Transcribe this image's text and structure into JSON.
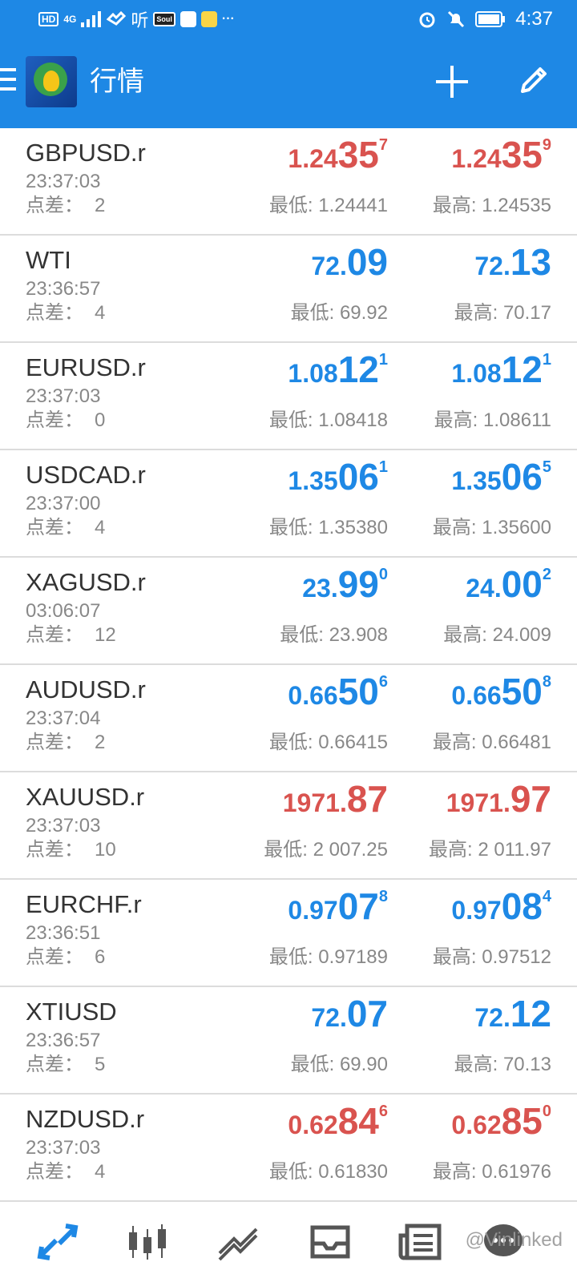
{
  "status_bar": {
    "hd": "HD",
    "network": "4G",
    "ting": "听",
    "soul": "Soul",
    "dots": "···",
    "time": "4:37"
  },
  "app_bar": {
    "title": "行情"
  },
  "labels": {
    "spread": "点差：",
    "low": "最低:",
    "high": "最高:"
  },
  "colors": {
    "accent": "#1e88e5",
    "down": "#d9534f",
    "up": "#1e88e5"
  },
  "quotes": [
    {
      "symbol": "GBPUSD.r",
      "time": "23:37:03",
      "spread": "2",
      "color": "red",
      "bid": {
        "s": "1.24",
        "b": "35",
        "t": "7"
      },
      "ask": {
        "s": "1.24",
        "b": "35",
        "t": "9"
      },
      "low": "1.24441",
      "high": "1.24535"
    },
    {
      "symbol": "WTI",
      "time": "23:36:57",
      "spread": "4",
      "color": "blue",
      "bid": {
        "s": "72.",
        "b": "09",
        "t": ""
      },
      "ask": {
        "s": "72.",
        "b": "13",
        "t": ""
      },
      "low": "69.92",
      "high": "70.17"
    },
    {
      "symbol": "EURUSD.r",
      "time": "23:37:03",
      "spread": "0",
      "color": "blue",
      "bid": {
        "s": "1.08",
        "b": "12",
        "t": "1"
      },
      "ask": {
        "s": "1.08",
        "b": "12",
        "t": "1"
      },
      "low": "1.08418",
      "high": "1.08611"
    },
    {
      "symbol": "USDCAD.r",
      "time": "23:37:00",
      "spread": "4",
      "color": "blue",
      "bid": {
        "s": "1.35",
        "b": "06",
        "t": "1"
      },
      "ask": {
        "s": "1.35",
        "b": "06",
        "t": "5"
      },
      "low": "1.35380",
      "high": "1.35600"
    },
    {
      "symbol": "XAGUSD.r",
      "time": "03:06:07",
      "spread": "12",
      "color": "blue",
      "bid": {
        "s": "23.",
        "b": "99",
        "t": "0"
      },
      "ask": {
        "s": "24.",
        "b": "00",
        "t": "2"
      },
      "low": "23.908",
      "high": "24.009"
    },
    {
      "symbol": "AUDUSD.r",
      "time": "23:37:04",
      "spread": "2",
      "color": "blue",
      "bid": {
        "s": "0.66",
        "b": "50",
        "t": "6"
      },
      "ask": {
        "s": "0.66",
        "b": "50",
        "t": "8"
      },
      "low": "0.66415",
      "high": "0.66481"
    },
    {
      "symbol": "XAUUSD.r",
      "time": "23:37:03",
      "spread": "10",
      "color": "red",
      "bid": {
        "s": "1971.",
        "b": "87",
        "t": ""
      },
      "ask": {
        "s": "1971.",
        "b": "97",
        "t": ""
      },
      "low": "2 007.25",
      "high": "2 011.97"
    },
    {
      "symbol": "EURCHF.r",
      "time": "23:36:51",
      "spread": "6",
      "color": "blue",
      "bid": {
        "s": "0.97",
        "b": "07",
        "t": "8"
      },
      "ask": {
        "s": "0.97",
        "b": "08",
        "t": "4"
      },
      "low": "0.97189",
      "high": "0.97512"
    },
    {
      "symbol": "XTIUSD",
      "time": "23:36:57",
      "spread": "5",
      "color": "blue",
      "bid": {
        "s": "72.",
        "b": "07",
        "t": ""
      },
      "ask": {
        "s": "72.",
        "b": "12",
        "t": ""
      },
      "low": "69.90",
      "high": "70.13"
    },
    {
      "symbol": "NZDUSD.r",
      "time": "23:37:03",
      "spread": "4",
      "color": "red",
      "bid": {
        "s": "0.62",
        "b": "84",
        "t": "6"
      },
      "ask": {
        "s": "0.62",
        "b": "85",
        "t": "0"
      },
      "low": "0.61830",
      "high": "0.61976"
    }
  ],
  "bottom_nav": {
    "items": [
      "quotes-icon",
      "chart-icon",
      "trade-icon",
      "history-icon",
      "news-icon",
      "chat-icon"
    ],
    "watermark": "@Vinlinked"
  }
}
